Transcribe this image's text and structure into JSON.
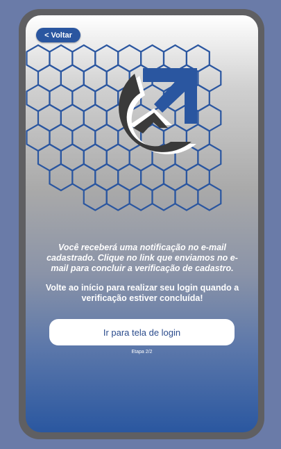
{
  "header": {
    "back_label": "< Voltar"
  },
  "logo": {
    "icon": "brand-g-logo-icon",
    "colors": {
      "dark": "#3a3a3a",
      "accent": "#2a56a0"
    }
  },
  "message": {
    "instruction": "Você receberá uma notificação no e-mail cadastrado. Clique no link que enviamos no e-mail para concluir a verificação de cadastro.",
    "return_note": "Volte ao início para realizar seu login quando a verificação estiver concluída!"
  },
  "actions": {
    "login_label": "Ir para tela de login"
  },
  "progress": {
    "step_label": "Etapa 2/2"
  },
  "colors": {
    "background": "#6a7ba8",
    "device": "#5f5f62",
    "primary": "#2a56a0",
    "button_text": "#2a4b8c"
  }
}
